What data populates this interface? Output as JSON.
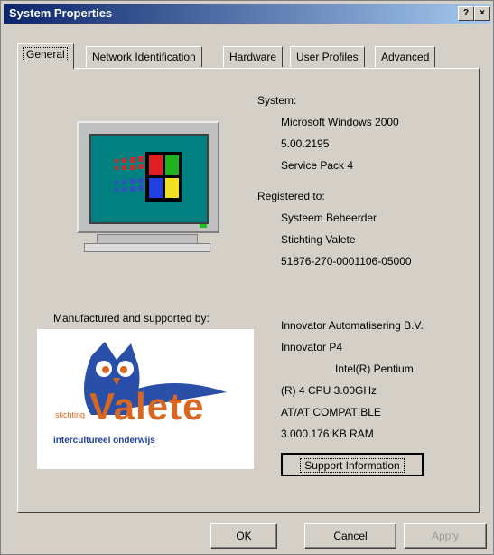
{
  "window": {
    "title": "System Properties",
    "help_button": "?",
    "close_button": "×"
  },
  "tabs": [
    {
      "label": "General"
    },
    {
      "label": "Network Identification"
    },
    {
      "label": "Hardware"
    },
    {
      "label": "User Profiles"
    },
    {
      "label": "Advanced"
    }
  ],
  "system": {
    "heading": "System:",
    "os": "Microsoft Windows 2000",
    "version": "5.00.2195",
    "service_pack": "Service Pack 4"
  },
  "registered": {
    "heading": "Registered to:",
    "name": "Systeem Beheerder",
    "organization": "Stichting Valete",
    "product_id": "51876-270-0001106-05000"
  },
  "manufacturer": {
    "heading": "Manufactured and supported by:",
    "name": "Innovator Automatisering B.V.",
    "model": "Innovator P4",
    "processor_1": "Intel(R) Pentium",
    "processor_2": "(R) 4 CPU 3.00GHz",
    "compat": "AT/AT COMPATIBLE",
    "ram": "3.000.176 KB RAM"
  },
  "logo": {
    "small_text": "stichting",
    "brand": "Valete",
    "tagline": "intercultureel onderwijs"
  },
  "buttons": {
    "support": "Support Information",
    "ok": "OK",
    "cancel": "Cancel",
    "apply": "Apply"
  },
  "colors": {
    "title_start": "#0a246a",
    "title_end": "#a6caf0",
    "brand_orange": "#d9671f",
    "brand_blue": "#1f3f9a"
  }
}
